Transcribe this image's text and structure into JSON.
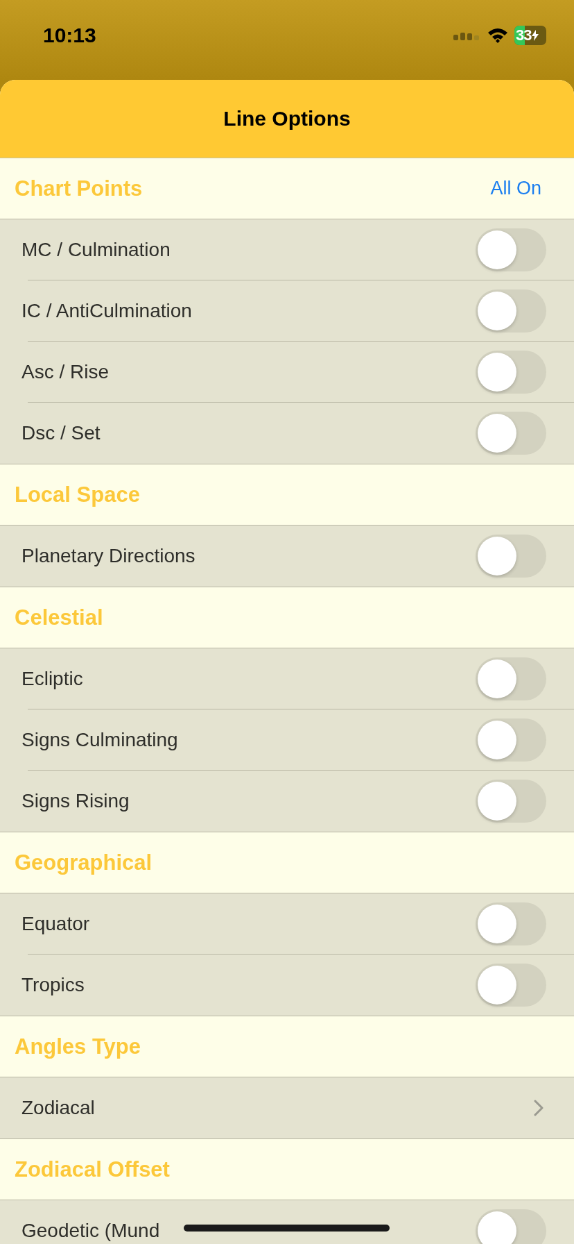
{
  "status_bar": {
    "time": "10:13",
    "battery": "33"
  },
  "title": "Line Options",
  "sections": [
    {
      "title": "Chart Points",
      "action": "All On",
      "rows": [
        {
          "kind": "toggle",
          "label": "MC / Culmination",
          "on": false
        },
        {
          "kind": "toggle",
          "label": "IC / AntiCulmination",
          "on": false
        },
        {
          "kind": "toggle",
          "label": "Asc / Rise",
          "on": false
        },
        {
          "kind": "toggle",
          "label": "Dsc / Set",
          "on": false
        }
      ]
    },
    {
      "title": "Local Space",
      "rows": [
        {
          "kind": "toggle",
          "label": "Planetary Directions",
          "on": false
        }
      ]
    },
    {
      "title": "Celestial",
      "rows": [
        {
          "kind": "toggle",
          "label": "Ecliptic",
          "on": false
        },
        {
          "kind": "toggle",
          "label": "Signs Culminating",
          "on": false
        },
        {
          "kind": "toggle",
          "label": "Signs Rising",
          "on": false
        }
      ]
    },
    {
      "title": "Geographical",
      "rows": [
        {
          "kind": "toggle",
          "label": "Equator",
          "on": false
        },
        {
          "kind": "toggle",
          "label": "Tropics",
          "on": false
        }
      ]
    },
    {
      "title": "Angles Type",
      "rows": [
        {
          "kind": "disclosure",
          "label": "Zodiacal"
        }
      ]
    },
    {
      "title": "Zodiacal Offset",
      "rows": [
        {
          "kind": "toggle",
          "label": "Geodetic (Mund",
          "on": false
        }
      ]
    }
  ]
}
